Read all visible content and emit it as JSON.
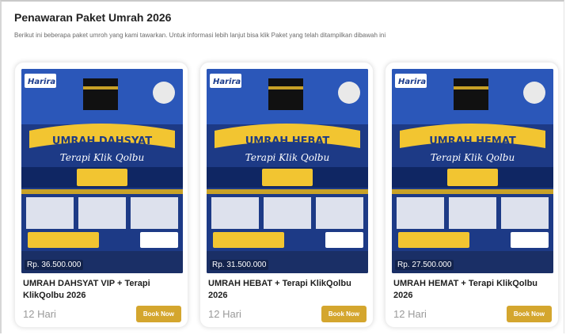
{
  "section": {
    "title": "Penawaran Paket Umrah 2026",
    "description": "Berikut ini beberapa paket umroh yang kami tawarkan. Untuk informasi lebih lanjut bisa klik Paket yang telah ditampilkan dibawah ini"
  },
  "packages": [
    {
      "poster_brand": "Harira",
      "poster_headline": "UMRAH DAHSYAT",
      "poster_sub": "Terapi Klik Qolbu",
      "price": "Rp. 36.500.000",
      "name": "UMRAH DAHSYAT VIP + Terapi KlikQolbu 2026",
      "duration": "12 Hari",
      "button": "Book Now"
    },
    {
      "poster_brand": "Harira",
      "poster_headline": "UMRAH HEBAT",
      "poster_sub": "Terapi Klik Qolbu",
      "price": "Rp. 31.500.000",
      "name": "UMRAH HEBAT + Terapi KlikQolbu 2026",
      "duration": "12 Hari",
      "button": "Book Now"
    },
    {
      "poster_brand": "Harira",
      "poster_headline": "UMRAH HEMAT",
      "poster_sub": "Terapi Klik Qolbu",
      "price": "Rp. 27.500.000",
      "name": "UMRAH HEMAT + Terapi KlikQolbu 2026",
      "duration": "12 Hari",
      "button": "Book Now"
    }
  ],
  "colors": {
    "accent": "#d4a62e",
    "poster_blue": "#1d3a86",
    "poster_gold": "#f2c531"
  }
}
